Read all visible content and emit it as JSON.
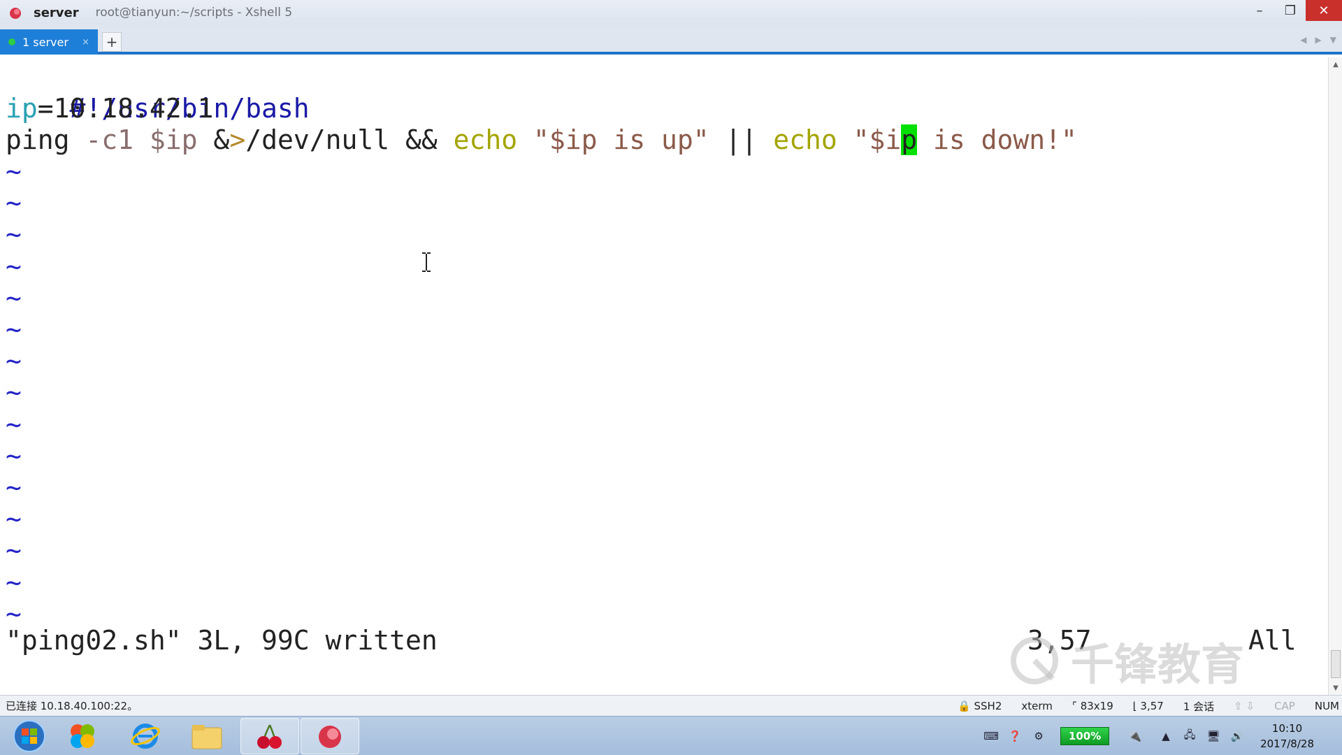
{
  "window": {
    "app_name": "server",
    "subtitle": "root@tianyun:~/scripts - Xshell 5",
    "minimize": "–",
    "maximize": "❐",
    "close": "✕"
  },
  "tabs": [
    {
      "label": "1 server",
      "close": "×"
    }
  ],
  "tab_add": "+",
  "terminal": {
    "line1": "#!/usr/bin/bash",
    "line2": {
      "var": "ip",
      "eq": "=10.18.42.1"
    },
    "line3": {
      "cmd": "ping ",
      "flag": "-c1 ",
      "var": "$ip ",
      "redir_amp": "&",
      "redir_gt": ">",
      "path": "/dev/null ",
      "and": "&& ",
      "echo1": "echo ",
      "str1": "\"$ip is up\" ",
      "or": "|| ",
      "echo2": "echo ",
      "str2_pre": "\"$i",
      "str2_cursor": "p",
      "str2_post": " is down!\""
    },
    "tilde": "~",
    "status_message": "\"ping02.sh\" 3L, 99C written",
    "status_position": "3,57",
    "status_all": "All",
    "watermark": "千锋教育"
  },
  "statusbar": {
    "connection": "已连接 10.18.40.100:22。",
    "protocol": "SSH2",
    "terminal_type": "xterm",
    "size": "83x19",
    "cursor_pos": "3,57",
    "sessions": "1 会话",
    "caps": "CAP",
    "num": "NUM"
  },
  "taskbar": {
    "battery": "100%",
    "time": "10:10",
    "date": "2017/8/28"
  },
  "colors": {
    "tab_active": "#1e7fd8",
    "tab_underline": "#1e73c8",
    "cursor": "#00e000",
    "tilde": "#2323c8",
    "close_button": "#c9302c"
  }
}
